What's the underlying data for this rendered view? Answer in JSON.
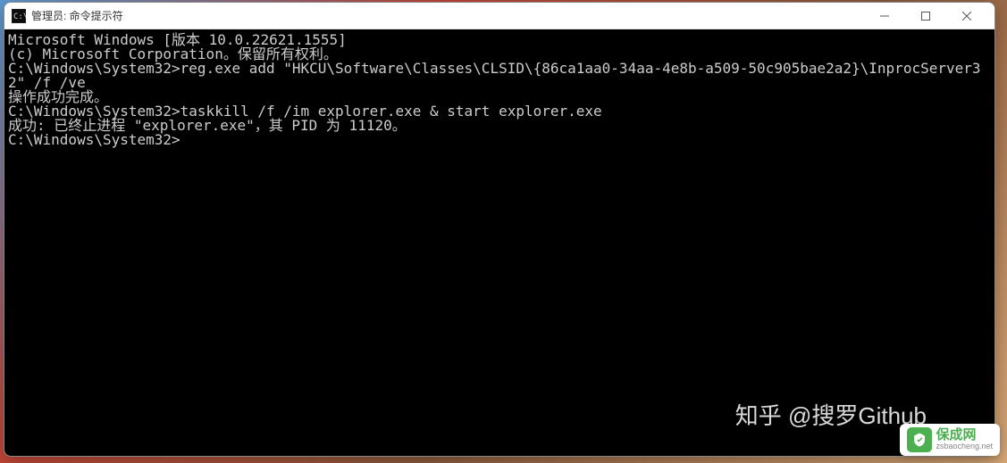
{
  "window": {
    "title": "管理员: 命令提示符"
  },
  "terminal": {
    "lines": [
      "Microsoft Windows [版本 10.0.22621.1555]",
      "(c) Microsoft Corporation。保留所有权利。",
      "",
      "C:\\Windows\\System32>reg.exe add \"HKCU\\Software\\Classes\\CLSID\\{86ca1aa0-34aa-4e8b-a509-50c905bae2a2}\\InprocServer32\" /f /ve",
      "操作成功完成。",
      "",
      "C:\\Windows\\System32>taskkill /f /im explorer.exe & start explorer.exe",
      "成功: 已终止进程 \"explorer.exe\"，其 PID 为 11120。",
      "",
      "C:\\Windows\\System32>"
    ]
  },
  "watermarks": {
    "zhihu": "知乎 @搜罗Github",
    "baocheng_name": "保成网",
    "baocheng_url": "zsbaocheng.net"
  }
}
